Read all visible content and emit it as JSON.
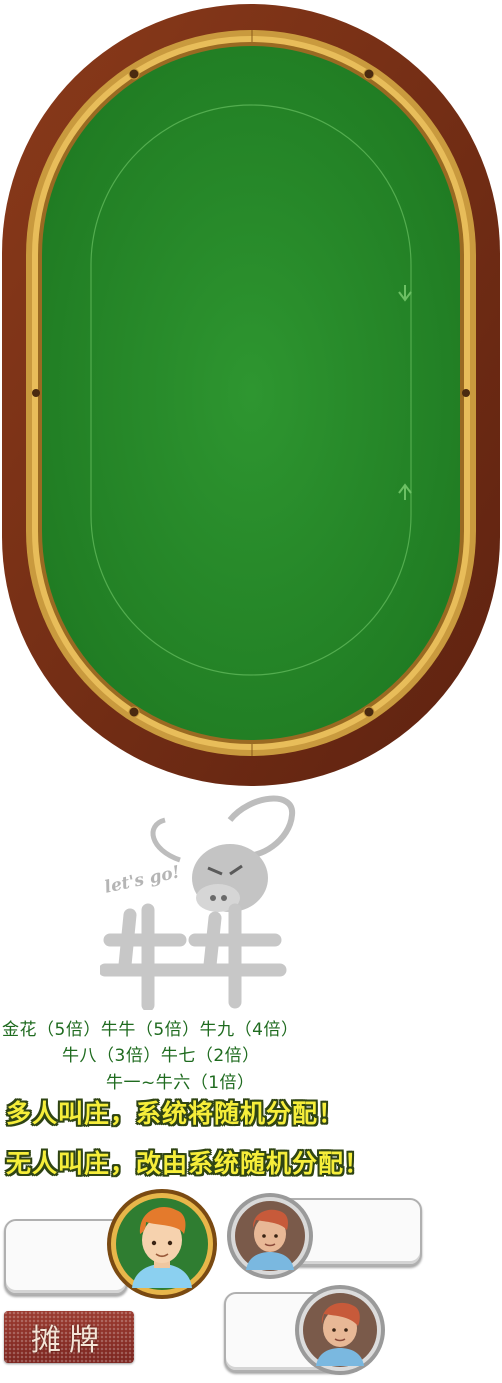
{
  "logo": {
    "text": "let's go!"
  },
  "odds": {
    "line1": "金花（5倍）牛牛（5倍）牛九（4倍）",
    "line2": "牛八（3倍）牛七（2倍）",
    "line3": "牛一~牛六（1倍）"
  },
  "messages": {
    "multi_banker": "多人叫庄，系统将随机分配！",
    "no_banker": "无人叫庄，改由系统随机分配！"
  },
  "buttons": {
    "tanpai": "摊牌"
  },
  "colors": {
    "felt": "#2a8a2c",
    "rail": "#7a2e14",
    "gold": "#d8a848",
    "odds_text": "#1f6b1f",
    "message_text": "#f6ee3a"
  }
}
